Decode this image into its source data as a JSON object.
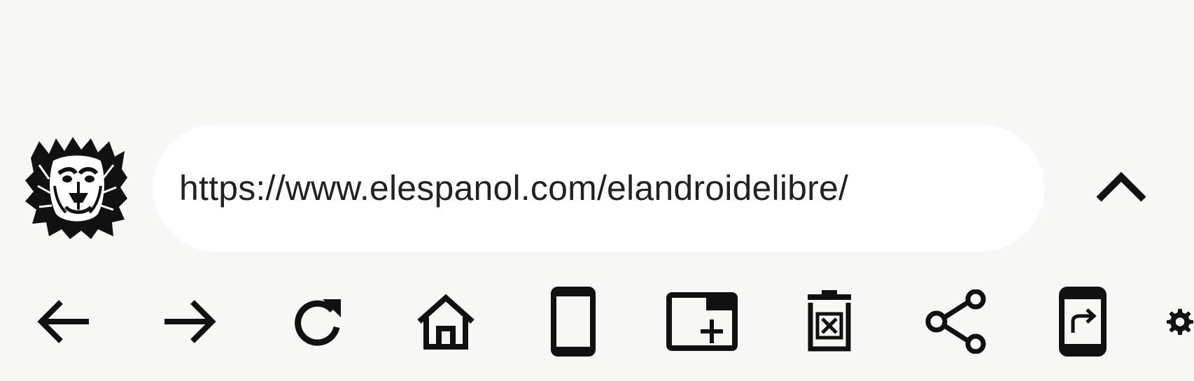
{
  "address_bar": {
    "url": "https://www.elespanol.com/elandroidelibre/"
  },
  "site": {
    "logo_icon": "lion-head-logo"
  },
  "controls": {
    "collapse_icon": "chevron-up-icon"
  },
  "toolbar": {
    "items": [
      {
        "icon": "arrow-back-icon"
      },
      {
        "icon": "arrow-forward-icon"
      },
      {
        "icon": "refresh-icon"
      },
      {
        "icon": "home-icon"
      },
      {
        "icon": "phone-device-icon"
      },
      {
        "icon": "add-tab-icon"
      },
      {
        "icon": "delete-tab-icon"
      },
      {
        "icon": "share-icon"
      },
      {
        "icon": "open-in-app-icon"
      },
      {
        "icon": "settings-icon"
      }
    ]
  },
  "colors": {
    "background": "#f7f7f5",
    "address_bar": "#ffffff",
    "icon": "#111111",
    "text": "#222222"
  }
}
